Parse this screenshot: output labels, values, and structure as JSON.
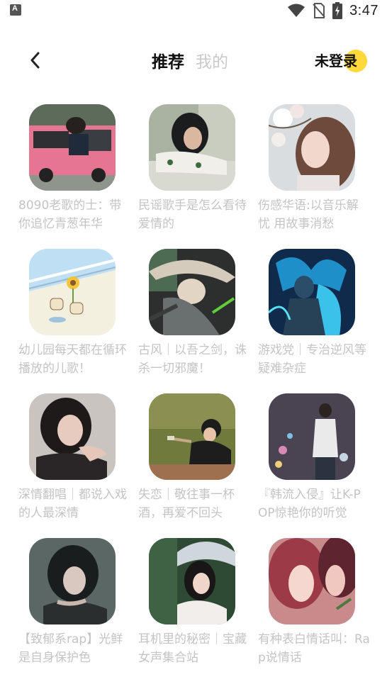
{
  "status_bar": {
    "time": "3:47",
    "icons": [
      "app-notification-icon",
      "wifi-icon",
      "no-sim-icon",
      "battery-charging-icon"
    ]
  },
  "nav": {
    "back_icon": "chevron-left-icon",
    "tabs": [
      {
        "label": "推荐",
        "active": true
      },
      {
        "label": "我的",
        "active": false
      }
    ],
    "login_label": "未登录",
    "accent_color": "#ffd83c"
  },
  "playlists": [
    {
      "title": "8090老歌的士：带你追忆青葱年华",
      "image": "pink-vintage-car-photo"
    },
    {
      "title": "民谣歌手是怎么看待爱情的",
      "image": "woman-leaning-on-table-photo"
    },
    {
      "title": "伤感华语:以音乐解忧 用故事消愁",
      "image": "woman-under-blossoms-photo"
    },
    {
      "title": "幼儿园每天都在循环播放的儿歌！",
      "image": "cartoon-bears-sunflower-illustration"
    },
    {
      "title": "古风｜以吾之剑，诛杀一切邪魔！",
      "image": "swordsman-straw-hat-illustration"
    },
    {
      "title": "游戏党｜专治逆风等疑难杂症",
      "image": "game-hero-blue-flame-illustration"
    },
    {
      "title": "深情翻唱｜都说入戏的人最深情",
      "image": "woman-portrait-hand-on-face-photo"
    },
    {
      "title": "失恋｜敬往事一杯酒，再爱不回头",
      "image": "woman-drinking-on-grass-photo"
    },
    {
      "title": "『韩流入侵』让K-POP惊艳你的听觉",
      "image": "man-standing-bokeh-photo"
    },
    {
      "title": "【致郁系rap】光鲜是自身保护色",
      "image": "dark-haired-girl-illustration"
    },
    {
      "title": "耳机里的秘密｜宝藏女声集合站",
      "image": "woman-with-umbrella-photo"
    },
    {
      "title": "有种表白情话叫：Rap说情话",
      "image": "anime-couple-illustration"
    }
  ]
}
